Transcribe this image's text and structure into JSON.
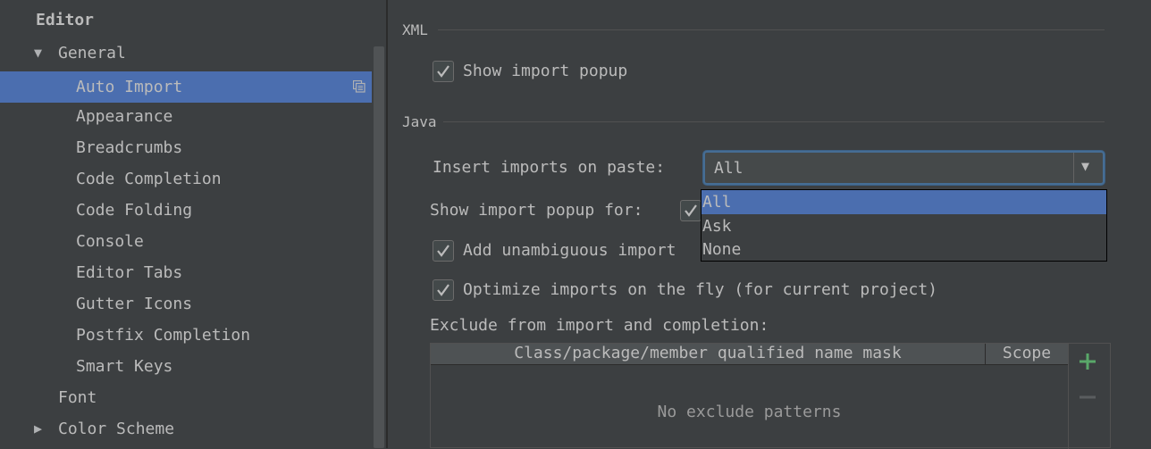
{
  "sidebar": {
    "root": "Editor",
    "items": [
      {
        "label": "General",
        "arrow": "▼"
      },
      {
        "label": "Auto Import"
      },
      {
        "label": "Appearance"
      },
      {
        "label": "Breadcrumbs"
      },
      {
        "label": "Code Completion"
      },
      {
        "label": "Code Folding"
      },
      {
        "label": "Console"
      },
      {
        "label": "Editor Tabs"
      },
      {
        "label": "Gutter Icons"
      },
      {
        "label": "Postfix Completion"
      },
      {
        "label": "Smart Keys"
      },
      {
        "label": "Font"
      },
      {
        "label": "Color Scheme",
        "arrow": "▶"
      }
    ],
    "selected_icon": "copy-settings-icon"
  },
  "xml": {
    "title": "XML",
    "show_import_popup": {
      "label": "Show import popup",
      "checked": true
    }
  },
  "java": {
    "title": "Java",
    "insert_imports_label": "Insert imports on paste:",
    "insert_imports_value": "All",
    "insert_imports_options": [
      "All",
      "Ask",
      "None"
    ],
    "show_popup_for_label": "Show import popup for:",
    "add_unambiguous": {
      "label": "Add unambiguous import",
      "checked": true
    },
    "optimize_imports": {
      "label": "Optimize imports on the fly (for current project)",
      "checked": true
    },
    "exclude_label": "Exclude from import and completion:",
    "table": {
      "columns": [
        "Class/package/member qualified name mask",
        "Scope"
      ],
      "empty_text": "No exclude patterns"
    }
  },
  "colors": {
    "selection": "#4b6eaf",
    "focus_border": "#466d94",
    "add_green": "#59a869"
  }
}
